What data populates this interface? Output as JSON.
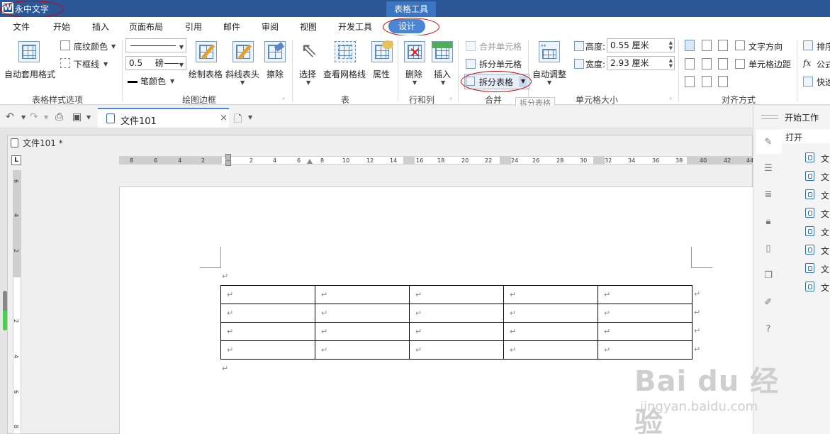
{
  "title_bar": {
    "logo_text": "W",
    "app_name": "永中文字",
    "context_tab": "表格工具"
  },
  "menu_tabs": [
    "文件",
    "开始",
    "插入",
    "页面布局",
    "引用",
    "邮件",
    "审阅",
    "视图",
    "开发工具",
    "设计"
  ],
  "active_tab": "设计",
  "ribbon": {
    "groups": {
      "table_style": "表格样式选项",
      "draw_border": "绘图边框",
      "table": "表",
      "row_col": "行和列",
      "merge": "合并",
      "cell_size": "单元格大小",
      "align": "对齐方式"
    },
    "auto_format": "自动套用格式",
    "shading": "底纹颜色",
    "border": "下框线",
    "line_width": "0.5",
    "line_unit": "磅",
    "pen_color": "笔颜色",
    "draw_table": "绘制表格",
    "diag_header": "斜线表头",
    "erase": "擦除",
    "select": "选择",
    "view_grid": "查看网格线",
    "properties": "属性",
    "delete": "删除",
    "insert": "插入",
    "merge_cells": "合并单元格",
    "split_cells": "拆分单元格",
    "split_table": "拆分表格",
    "auto_fit": "自动调整",
    "height_label": "高度:",
    "height_value": "0.55 厘米",
    "width_label": "宽度:",
    "width_value": "2.93 厘米",
    "text_direction": "文字方向",
    "cell_margin": "单元格边距",
    "arrange": "排序",
    "formula": "公式",
    "quick": "快速",
    "tooltip": "拆分表格"
  },
  "doc_tab": {
    "title": "文件101",
    "close": "×"
  },
  "doc_window_title": "文件101 *",
  "ruler_h_ticks": [
    "8",
    "6",
    "4",
    "2",
    "2",
    "4",
    "6",
    "8",
    "10",
    "12",
    "14",
    "16",
    "18",
    "20",
    "22",
    "24",
    "26",
    "28",
    "30",
    "32",
    "34",
    "36",
    "38",
    "40",
    "42",
    "44"
  ],
  "ruler_v_ticks": [
    "6",
    "4",
    "2",
    "2",
    "4",
    "6",
    "8"
  ],
  "ruler_corner": "L",
  "paragraph_mark": "↵",
  "table": {
    "rows": 4,
    "cols": 5
  },
  "right_panel": {
    "start_work": "开始工作",
    "open": "打开",
    "files": [
      "文",
      "文",
      "文",
      "文",
      "文",
      "文",
      "文",
      "文"
    ]
  },
  "watermark": {
    "line1": "Bai du 经验",
    "line2": "jingyan.baidu.com"
  },
  "colors": {
    "title_bar": "#2b5797",
    "active_tab": "#4a86d4",
    "annotation": "#cc0000"
  }
}
